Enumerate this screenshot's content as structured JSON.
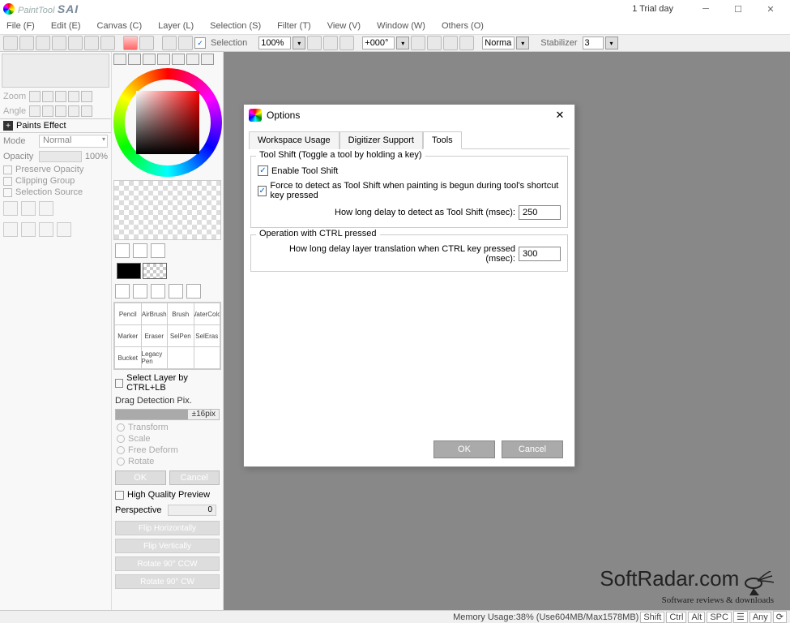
{
  "titlebar": {
    "app_prefix": "PaintTool",
    "app_bold": "SAI",
    "trial": "1 Trial day"
  },
  "menubar": {
    "file": "File (F)",
    "edit": "Edit (E)",
    "canvas": "Canvas (C)",
    "layer": "Layer (L)",
    "selection": "Selection (S)",
    "filter": "Filter (T)",
    "view": "View (V)",
    "window": "Window (W)",
    "others": "Others (O)"
  },
  "toolstrip": {
    "selection_label": "Selection",
    "zoom": "100%",
    "angle": "+000°",
    "mode": "Normal",
    "stabilizer_label": "Stabilizer",
    "stabilizer_value": "3"
  },
  "left": {
    "zoom_lbl": "Zoom",
    "angle_lbl": "Angle",
    "paints_effect": "Paints Effect",
    "mode_lbl": "Mode",
    "mode_val": "Normal",
    "opacity_lbl": "Opacity",
    "opacity_val": "100%",
    "preserve": "Preserve Opacity",
    "clipping": "Clipping Group",
    "selsrc": "Selection Source"
  },
  "mid": {
    "tools": [
      "Pencil",
      "AirBrush",
      "Brush",
      "WaterColor",
      "Marker",
      "Eraser",
      "SelPen",
      "SelEras",
      "Bucket",
      "Legacy Pen",
      "",
      ""
    ],
    "sel_layer": "Select Layer by CTRL+LB",
    "drag_det": "Drag Detection Pix.",
    "drag_val": "±16pix",
    "transform": "Transform",
    "scale": "Scale",
    "free": "Free Deform",
    "rotate": "Rotate",
    "ok": "OK",
    "cancel": "Cancel",
    "hq": "High Quality Preview",
    "perspective": "Perspective",
    "perspective_val": "0",
    "flip_h": "Flip Horizontally",
    "flip_v": "Flip Vertically",
    "rot_ccw": "Rotate 90° CCW",
    "rot_cw": "Rotate 90° CW"
  },
  "modal": {
    "title": "Options",
    "tabs": {
      "t1": "Workspace Usage",
      "t2": "Digitizer Support",
      "t3": "Tools"
    },
    "g1": {
      "legend": "Tool Shift (Toggle a tool by holding a key)",
      "enable": "Enable Tool Shift",
      "force": "Force to detect as Tool Shift when painting is begun during tool's shortcut key pressed",
      "delay_lbl": "How long delay to detect as Tool Shift (msec):",
      "delay_val": "250"
    },
    "g2": {
      "legend": "Operation with CTRL pressed",
      "delay_lbl": "How long delay layer translation when CTRL key pressed (msec):",
      "delay_val": "300"
    },
    "ok": "OK",
    "cancel": "Cancel"
  },
  "status": {
    "memory": "Memory Usage:38% (Use604MB/Max1578MB)",
    "pills": [
      "Shift",
      "Ctrl",
      "Alt",
      "SPC",
      "☰",
      "Any",
      "⟳"
    ]
  },
  "watermark": {
    "name": "SoftRadar.com",
    "tagline": "Software reviews & downloads"
  }
}
